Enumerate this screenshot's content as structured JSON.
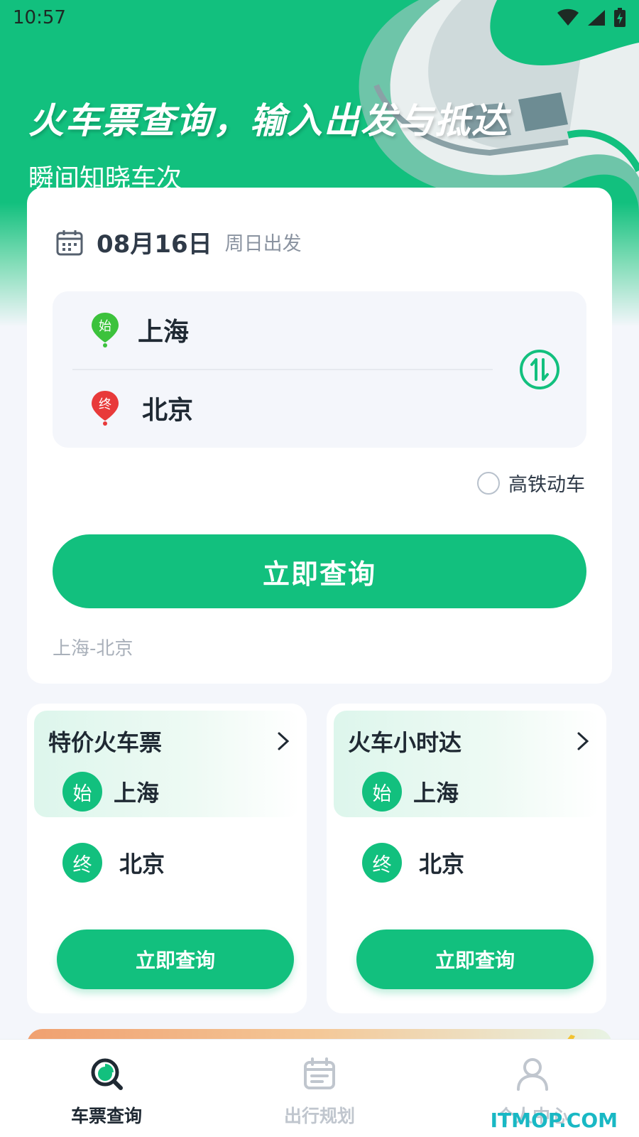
{
  "status_bar": {
    "time": "10:57"
  },
  "hero": {
    "title": "火车票查询，输入出发与抵达",
    "subtitle": "瞬间知晓车次"
  },
  "search": {
    "date": "08月16日",
    "weekday": "周日出发",
    "from": "上海",
    "to": "北京",
    "from_badge": "始",
    "to_badge": "终",
    "filter_label": "高铁动车",
    "filter_checked": false,
    "query_button": "立即查询",
    "history": "上海-北京"
  },
  "cards": [
    {
      "title": "特价火车票",
      "from_badge": "始",
      "from": "上海",
      "to_badge": "终",
      "to": "北京",
      "button": "立即查询"
    },
    {
      "title": "火车小时达",
      "from_badge": "始",
      "from": "上海",
      "to_badge": "终",
      "to": "北京",
      "button": "立即查询"
    }
  ],
  "tabbar": {
    "items": [
      {
        "label": "车票查询",
        "icon": "ticket-search-icon",
        "active": true
      },
      {
        "label": "出行规划",
        "icon": "calendar-icon",
        "active": false
      },
      {
        "label": "个人中心",
        "icon": "user-icon",
        "active": false
      }
    ]
  },
  "watermark": "ITMOP.COM",
  "colors": {
    "accent": "#12c07e",
    "start_pin": "#3cc23c",
    "end_pin": "#e83a3a",
    "text_dark": "#1f2933",
    "text_muted": "#8a93a0"
  }
}
